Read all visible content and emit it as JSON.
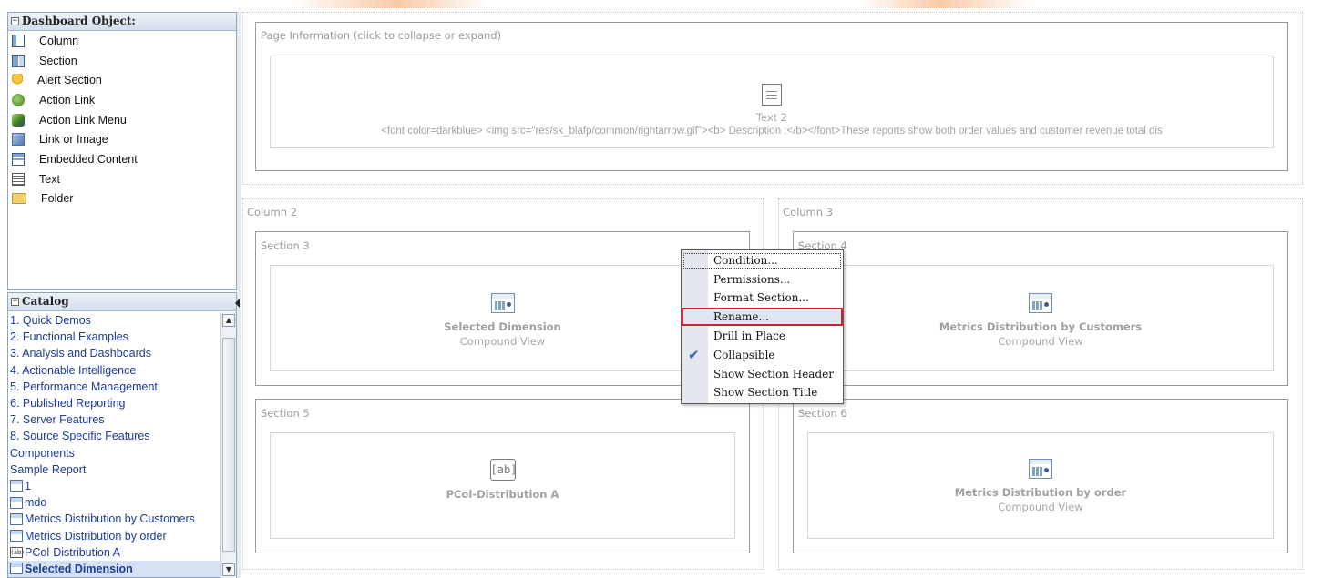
{
  "dashboard_objects": {
    "title": "Dashboard Object:",
    "items": [
      {
        "label": "Column",
        "icon": "column-icon"
      },
      {
        "label": "Section",
        "icon": "section-icon"
      },
      {
        "label": "Alert Section",
        "icon": "bell-icon"
      },
      {
        "label": "Action Link",
        "icon": "action-link-icon"
      },
      {
        "label": "Action Link Menu",
        "icon": "action-link-menu-icon"
      },
      {
        "label": "Link or Image",
        "icon": "link-image-icon"
      },
      {
        "label": "Embedded Content",
        "icon": "embedded-content-icon"
      },
      {
        "label": "Text",
        "icon": "text-icon"
      },
      {
        "label": "Folder",
        "icon": "folder-icon"
      }
    ]
  },
  "catalog": {
    "title": "Catalog",
    "items": [
      {
        "label": "1. Quick Demos",
        "icon": "none"
      },
      {
        "label": "2. Functional Examples",
        "icon": "none"
      },
      {
        "label": "3. Analysis and Dashboards",
        "icon": "none"
      },
      {
        "label": "4. Actionable Intelligence",
        "icon": "none"
      },
      {
        "label": "5. Performance Management",
        "icon": "none"
      },
      {
        "label": "6. Published Reporting",
        "icon": "none"
      },
      {
        "label": "7. Server Features",
        "icon": "none"
      },
      {
        "label": "8. Source Specific Features",
        "icon": "none"
      },
      {
        "label": "Components",
        "icon": "none"
      },
      {
        "label": "Sample Report",
        "icon": "none"
      },
      {
        "label": "1",
        "icon": "report-icon"
      },
      {
        "label": "mdo",
        "icon": "report-icon"
      },
      {
        "label": "Metrics Distribution by Customers",
        "icon": "report-icon"
      },
      {
        "label": "Metrics Distribution by order",
        "icon": "report-icon"
      },
      {
        "label": "PCol-Distribution A",
        "icon": "ab-icon"
      },
      {
        "label": "Selected Dimension",
        "icon": "report-icon",
        "selected": true
      }
    ]
  },
  "page_info": {
    "label": "Page Information (click to collapse or expand)",
    "text_title": "Text 2",
    "text_content": "<font color=darkblue> <img src=\"res/sk_blafp/common/rightarrow.gif\"><b> Description :</b></font>These reports show both order values and customer revenue total dis"
  },
  "columns": [
    {
      "label": "Column 2"
    },
    {
      "label": "Column 3"
    }
  ],
  "sections": {
    "s3": {
      "label": "Section 3",
      "title": "Selected Dimension",
      "subtitle": "Compound View"
    },
    "s4": {
      "label": "Section 4",
      "title": "Metrics Distribution by Customers",
      "subtitle": "Compound View"
    },
    "s5": {
      "label": "Section 5",
      "title": "PCol-Distribution A",
      "icon_text": "[ab]"
    },
    "s6": {
      "label": "Section 6",
      "title": "Metrics Distribution by order",
      "subtitle": "Compound View"
    }
  },
  "context_menu": {
    "items": [
      {
        "label": "Condition..."
      },
      {
        "label": "Permissions..."
      },
      {
        "label": "Format Section..."
      },
      {
        "label": "Rename...",
        "highlighted": true
      },
      {
        "label": "Drill in Place"
      },
      {
        "label": "Collapsible",
        "checked": true
      },
      {
        "label": "Show Section Header"
      },
      {
        "label": "Show Section Title"
      }
    ]
  },
  "colors": {
    "highlight_border": "#d81e2a",
    "link_text": "#1a3c9a",
    "check": "#3a63b6"
  }
}
